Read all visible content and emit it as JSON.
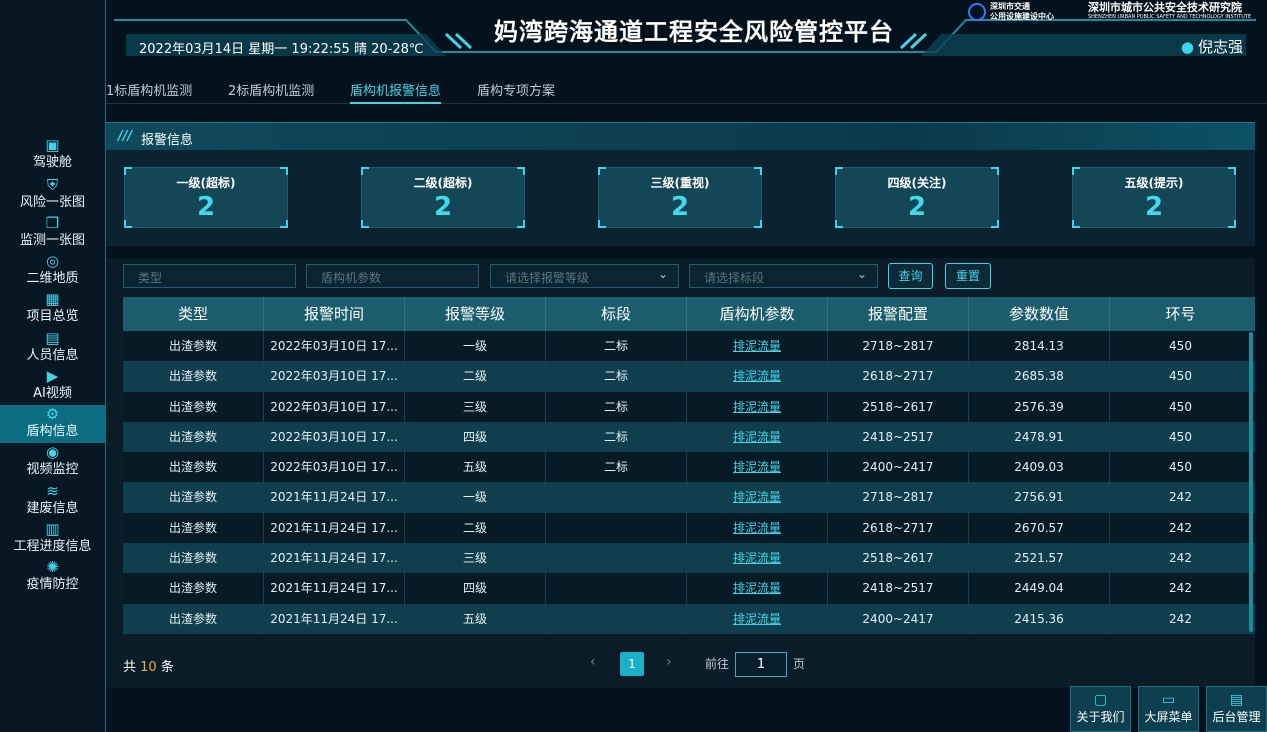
{
  "header": {
    "title": "妈湾跨海通道工程安全风险管控平台",
    "datetime": "2022年03月14日 星期一 19:22:55 晴 20-28℃",
    "user": "倪志强",
    "logo_left_line1": "深圳市交通",
    "logo_left_line2": "公用设施建设中心",
    "logo_right_title": "深圳市城市公共安全技术研究院",
    "logo_right_sub": "SHENZHEN URBAN PUBLIC SAFETY AND TECHNOLOGY INSTITUTE"
  },
  "sidebar": {
    "items": [
      {
        "label": "驾驶舱",
        "icon": "dashboard-icon"
      },
      {
        "label": "风险一张图",
        "icon": "shield-icon"
      },
      {
        "label": "监测一张图",
        "icon": "cube-icon"
      },
      {
        "label": "二维地质",
        "icon": "eye-icon"
      },
      {
        "label": "项目总览",
        "icon": "grid-icon"
      },
      {
        "label": "人员信息",
        "icon": "id-card-icon"
      },
      {
        "label": "AI视频",
        "icon": "play-circle-icon"
      },
      {
        "label": "盾构信息",
        "icon": "gear-icon"
      },
      {
        "label": "视频监控",
        "icon": "camera-icon"
      },
      {
        "label": "建废信息",
        "icon": "layers-icon"
      },
      {
        "label": "工程进度信息",
        "icon": "bar-chart-icon"
      },
      {
        "label": "疫情防控",
        "icon": "virus-icon"
      }
    ],
    "active_index": 7
  },
  "tabs": [
    {
      "label": "1标盾构机监测"
    },
    {
      "label": "2标盾构机监测"
    },
    {
      "label": "盾构机报警信息"
    },
    {
      "label": "盾构专项方案"
    }
  ],
  "alarm_section": {
    "title": "报警信息",
    "cards": [
      {
        "label": "一级(超标)",
        "value": "2"
      },
      {
        "label": "二级(超标)",
        "value": "2"
      },
      {
        "label": "三级(重视)",
        "value": "2"
      },
      {
        "label": "四级(关注)",
        "value": "2"
      },
      {
        "label": "五级(提示)",
        "value": "2"
      }
    ]
  },
  "filters": {
    "type_placeholder": "类型",
    "param_placeholder": "盾构机参数",
    "level_placeholder": "请选择报警等级",
    "section_placeholder": "请选择标段",
    "query_label": "查询",
    "reset_label": "重置"
  },
  "table": {
    "columns": [
      "类型",
      "报警时间",
      "报警等级",
      "标段",
      "盾构机参数",
      "报警配置",
      "参数数值",
      "环号"
    ],
    "rows": [
      [
        "出渣参数",
        "2022年03月10日 17...",
        "一级",
        "二标",
        "排泥流量",
        "2718~2817",
        "2814.13",
        "450"
      ],
      [
        "出渣参数",
        "2022年03月10日 17...",
        "二级",
        "二标",
        "排泥流量",
        "2618~2717",
        "2685.38",
        "450"
      ],
      [
        "出渣参数",
        "2022年03月10日 17...",
        "三级",
        "二标",
        "排泥流量",
        "2518~2617",
        "2576.39",
        "450"
      ],
      [
        "出渣参数",
        "2022年03月10日 17...",
        "四级",
        "二标",
        "排泥流量",
        "2418~2517",
        "2478.91",
        "450"
      ],
      [
        "出渣参数",
        "2022年03月10日 17...",
        "五级",
        "二标",
        "排泥流量",
        "2400~2417",
        "2409.03",
        "450"
      ],
      [
        "出渣参数",
        "2021年11月24日 17...",
        "一级",
        "",
        "排泥流量",
        "2718~2817",
        "2756.91",
        "242"
      ],
      [
        "出渣参数",
        "2021年11月24日 17...",
        "二级",
        "",
        "排泥流量",
        "2618~2717",
        "2670.57",
        "242"
      ],
      [
        "出渣参数",
        "2021年11月24日 17...",
        "三级",
        "",
        "排泥流量",
        "2518~2617",
        "2521.57",
        "242"
      ],
      [
        "出渣参数",
        "2021年11月24日 17...",
        "四级",
        "",
        "排泥流量",
        "2418~2517",
        "2449.04",
        "242"
      ],
      [
        "出渣参数",
        "2021年11月24日 17...",
        "五级",
        "",
        "排泥流量",
        "2400~2417",
        "2415.36",
        "242"
      ]
    ]
  },
  "pagination": {
    "total_prefix": "共",
    "total_count": "10",
    "total_suffix": "条",
    "current_page": "1",
    "goto_label": "前往",
    "goto_value": "1",
    "page_unit": "页"
  },
  "footer_buttons": [
    {
      "label": "关于我们",
      "icon": "document-icon"
    },
    {
      "label": "大屏菜单",
      "icon": "monitor-icon"
    },
    {
      "label": "后台管理",
      "icon": "admin-panel-icon"
    }
  ],
  "colors": {
    "accent": "#43d3e8",
    "highlight": "#f4a640",
    "background": "#04121d"
  }
}
